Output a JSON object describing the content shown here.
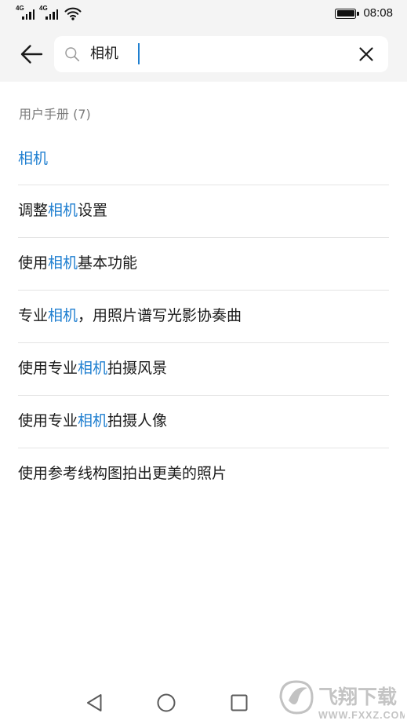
{
  "status_bar": {
    "sim1_label": "4G",
    "sim2_label": "4G",
    "signal_levels": [
      4,
      4
    ],
    "wifi_icon": "wifi-icon",
    "battery_level": 1.0,
    "time": "08:08"
  },
  "header": {
    "back_icon": "arrow-left-icon",
    "search_icon": "search-icon",
    "search_query": "相机",
    "clear_icon": "close-icon"
  },
  "section": {
    "title": "用户手册 (7)"
  },
  "results": [
    {
      "before": "",
      "highlight": "相机",
      "after": ""
    },
    {
      "before": "调整",
      "highlight": "相机",
      "after": "设置"
    },
    {
      "before": "使用",
      "highlight": "相机",
      "after": "基本功能"
    },
    {
      "before": "专业",
      "highlight": "相机",
      "after": "，用照片谱写光影协奏曲"
    },
    {
      "before": "使用专业",
      "highlight": "相机",
      "after": "拍摄风景"
    },
    {
      "before": "使用专业",
      "highlight": "相机",
      "after": "拍摄人像"
    },
    {
      "before": "使用参考线构图拍出更美的照片",
      "highlight": "",
      "after": ""
    }
  ],
  "nav_bar": {
    "back_icon": "triangle-back-icon",
    "home_icon": "circle-home-icon",
    "recents_icon": "square-recents-icon"
  },
  "watermark": {
    "text": "飞翔下载",
    "url_text": "WWW.FXXZ.COM"
  },
  "colors": {
    "highlight": "#1f7fd0",
    "header_bg": "#f4f4f4",
    "divider": "#e4e4e4",
    "section_title": "#7a7a7a"
  }
}
